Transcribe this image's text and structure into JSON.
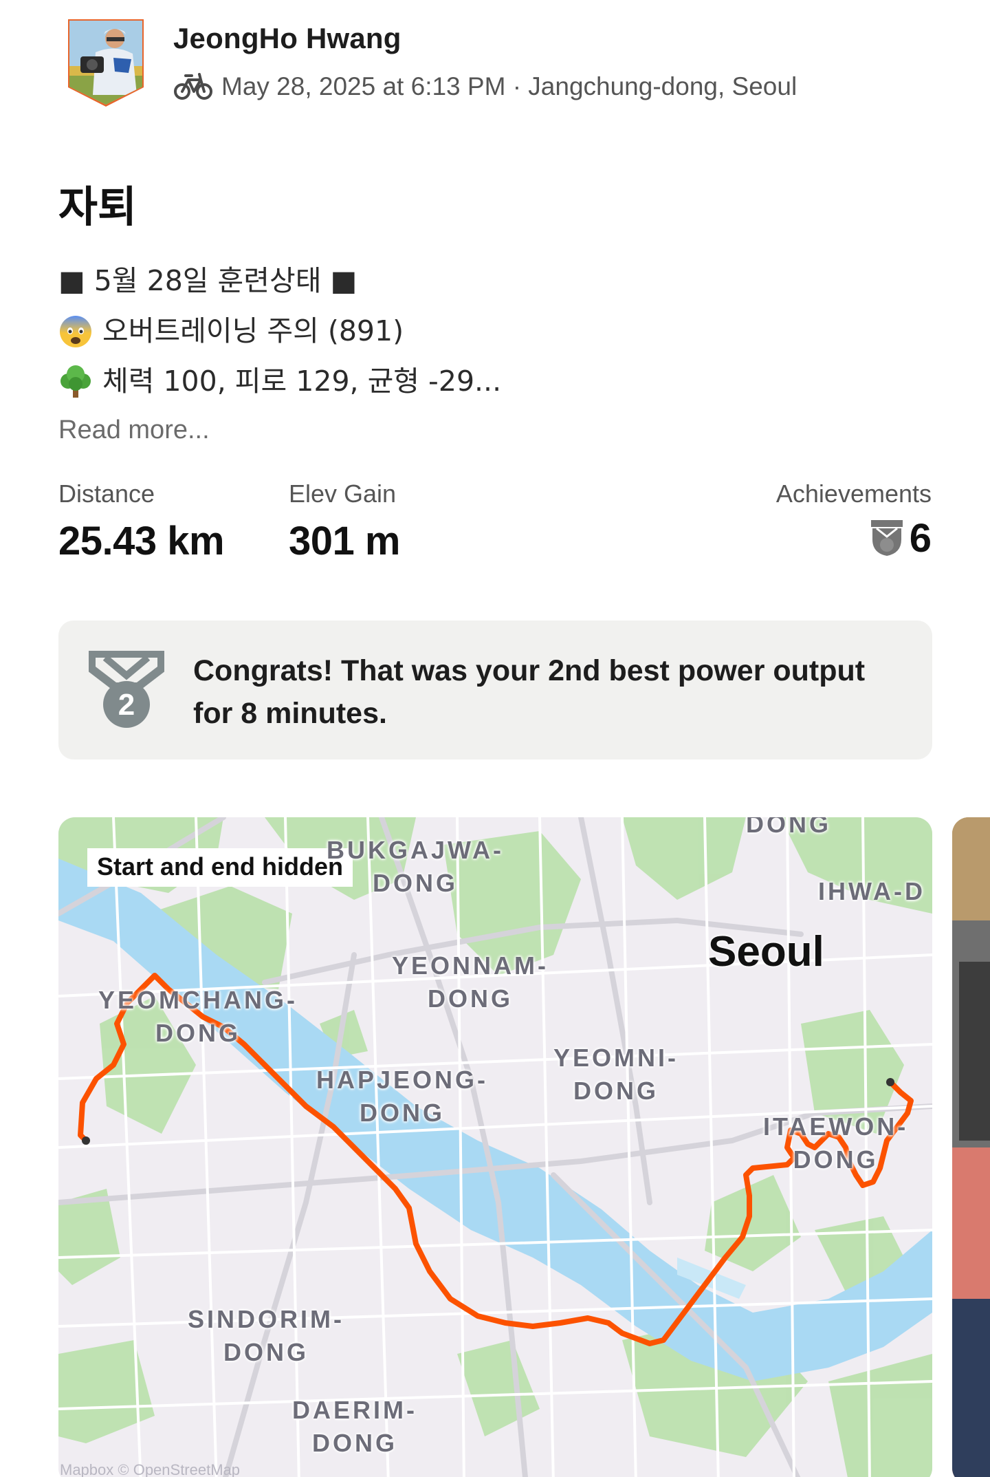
{
  "header": {
    "athlete_name": "JeongHo Hwang",
    "meta": "May 28, 2025 at 6:13 PM · Jangchung-dong, Seoul",
    "activity_icon": "bike-icon",
    "avatar_icon": "avatar-badge"
  },
  "activity": {
    "title": "자퇴",
    "description_lines": [
      {
        "emoji": "",
        "text": "■ 5월 28일 훈련상태 ■"
      },
      {
        "emoji": "fearful-face-icon",
        "text": "오버트레이닝 주의 (891)"
      },
      {
        "emoji": "tree-icon",
        "text": "체력 100, 피로 129, 균형 -29..."
      }
    ],
    "read_more": "Read more..."
  },
  "stats": {
    "distance_label": "Distance",
    "distance_value": "25.43 km",
    "elev_label": "Elev Gain",
    "elev_value": "301 m",
    "achievements_label": "Achievements",
    "achievements_value": "6",
    "achievements_icon": "trophy-icon"
  },
  "congrats": {
    "icon": "medal-icon",
    "medal_number": "2",
    "text": "Congrats! That was your 2nd best power output for 8 minutes."
  },
  "map": {
    "badge": "Start and end hidden",
    "city": "Seoul",
    "attribution": "Mapbox © OpenStreetMap",
    "labels": {
      "dong_top": "DONG",
      "bukgajwa": "BUKGAJWA-\nDONG",
      "ihwa": "IHWA-D",
      "yeonnam": "YEONNAM-\nDONG",
      "yeomchang": "YEOMCHANG-\nDONG",
      "hapjeong": "HAPJEONG-\nDONG",
      "yeomni": "YEOMNI-\nDONG",
      "itaewon": "ITAEWON-\nDONG",
      "sindorim": "SINDORIM-\nDONG",
      "daerim": "DAERIM-\nDONG"
    },
    "route_color": "#fc5200",
    "water_color": "#aedcf6",
    "park_color": "#b7dfa8"
  }
}
